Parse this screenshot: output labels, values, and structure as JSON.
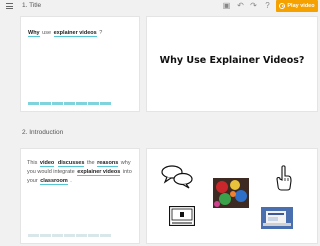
{
  "toolbar": {
    "menu_icon": "hamburger-icon",
    "icons": [
      "image-icon",
      "undo-icon",
      "redo-icon",
      "help-icon"
    ],
    "play_button": "Play video",
    "accent": "#f5a100"
  },
  "scenes": [
    {
      "title": "1. Title",
      "script": {
        "w1": "Why",
        "w2": "use",
        "w3": "explainer videos",
        "w4": "?"
      },
      "progress": {
        "segments": 7,
        "filled": 7
      },
      "preview_heading": "Why Use Explainer Videos?"
    },
    {
      "title": "2. Introduction",
      "script": {
        "w1": "This",
        "w2": "video",
        "w3": "discusses",
        "w4": "the",
        "w5": "reasons",
        "w6": "why you",
        "w7": "would integrate",
        "w8": "explainer videos",
        "w9": "into your",
        "w10": "classroom",
        "w11": "."
      },
      "progress": {
        "segments": 7,
        "filled": 0
      },
      "preview_images": [
        "speech-bubbles-icon",
        "crafts-photo",
        "pointing-hand-icon",
        "video-player-icon",
        "laptop-photo"
      ]
    }
  ]
}
